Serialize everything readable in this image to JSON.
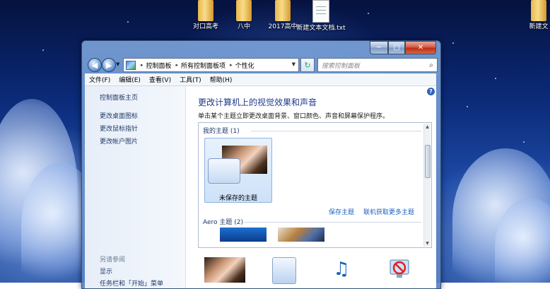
{
  "desktop": {
    "icons": [
      {
        "label": "对口高考",
        "kind": "folder"
      },
      {
        "label": "八中",
        "kind": "folder"
      },
      {
        "label": "2017高中",
        "kind": "folder"
      },
      {
        "label": "新建文本文档.txt",
        "kind": "text-file"
      },
      {
        "label": "新建文",
        "kind": "folder"
      }
    ]
  },
  "window": {
    "caption_buttons": {
      "minimize": "─",
      "maximize": "□",
      "close": "✕"
    },
    "nav": {
      "back": "◀",
      "forward": "▶"
    },
    "breadcrumbs": [
      "控制面板",
      "所有控制面板项",
      "个性化"
    ],
    "breadcrumb_separator": "▸",
    "search_placeholder": "搜索控制面板",
    "menu": [
      "文件(F)",
      "编辑(E)",
      "查看(V)",
      "工具(T)",
      "帮助(H)"
    ],
    "sidebar": {
      "home": "控制面板主页",
      "links": [
        "更改桌面图标",
        "更改鼠标指针",
        "更改帐户图片"
      ],
      "see_also": "另请参阅",
      "see_also_links": [
        "显示",
        "任务栏和「开始」菜单"
      ]
    },
    "main": {
      "title": "更改计算机上的视觉效果和声音",
      "subtitle": "单击某个主题立即更改桌面背景、窗口颜色、声音和屏幕保护程序。",
      "my_themes_label": "我的主题 (1)",
      "unsaved_theme": "未保存的主题",
      "save_theme": "保存主题",
      "get_more_themes": "联机获取更多主题",
      "aero_label": "Aero 主题 (2)"
    }
  }
}
